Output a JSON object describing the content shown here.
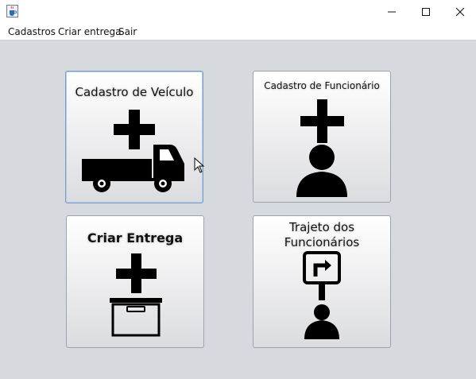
{
  "window": {
    "icon": "java-cup-icon",
    "controls": [
      "minimize-icon",
      "maximize-icon",
      "close-icon"
    ]
  },
  "menu": {
    "items": [
      {
        "label": "Cadastros"
      },
      {
        "label": "Criar entrega"
      },
      {
        "label": "Sair"
      }
    ]
  },
  "tiles": [
    {
      "label": "Cadastro de Veículo",
      "icon": "add-truck-icon"
    },
    {
      "label": "Cadastro de Funcionário",
      "icon": "add-person-icon"
    },
    {
      "label": "Criar Entrega",
      "icon": "add-box-icon"
    },
    {
      "label_line1": "Trajeto dos",
      "label_line2": "Funcionários",
      "icon": "route-sign-person-icon"
    }
  ],
  "colors": {
    "background": "#d6d9de",
    "focus_border": "#7a9cc6",
    "icon": "#000000"
  }
}
